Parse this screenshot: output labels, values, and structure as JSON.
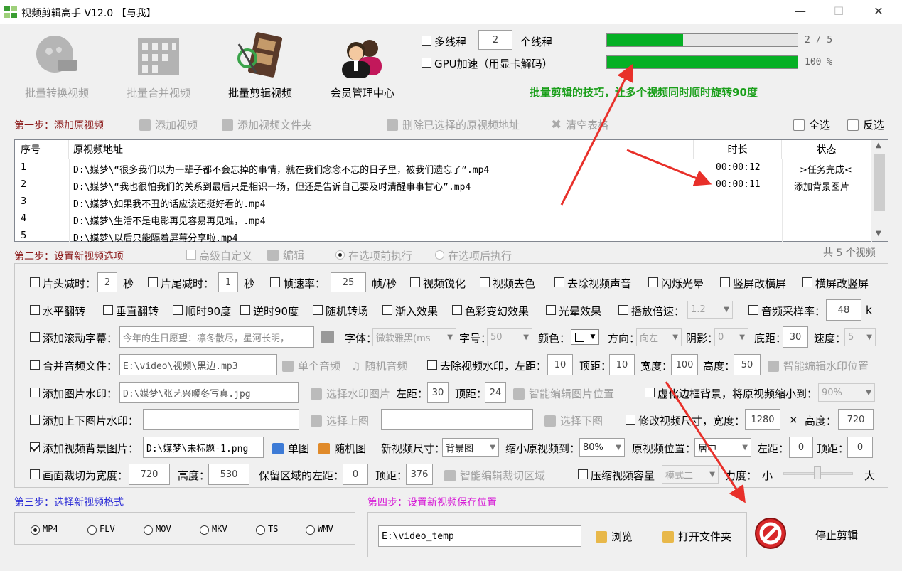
{
  "window": {
    "title": "视频剪辑高手 V12.0  【与我】"
  },
  "toolbar": [
    {
      "label": "批量转换视频",
      "icon": "batch-convert-icon"
    },
    {
      "label": "批量合并视频",
      "icon": "batch-merge-icon"
    },
    {
      "label": "批量剪辑视频",
      "icon": "film-reel-icon"
    },
    {
      "label": "会员管理中心",
      "icon": "members-icon"
    }
  ],
  "threads": {
    "multi_label": "多线程",
    "count": "2",
    "unit": "个线程",
    "gpu_label": "GPU加速（用显卡解码）"
  },
  "progress": {
    "file_text": "2 / 5",
    "file_fraction": 0.4,
    "overall_text": "100 %",
    "overall_fraction": 1.0
  },
  "tip": "批量剪辑的技巧，让多个视频同时顺时旋转90度",
  "step1": {
    "title": "第一步：添加原视频",
    "add_video": "添加视频",
    "add_folder": "添加视频文件夹",
    "delete_selected": "删除已选择的原视频地址",
    "clear_table": "清空表格",
    "select_all": "全选",
    "invert": "反选"
  },
  "table": {
    "headers": [
      "序号",
      "原视频地址",
      "时长",
      "状态"
    ],
    "rows": [
      {
        "no": "1",
        "path": "D:\\媒梦\\“很多我们以为一辈子都不会忘掉的事情，就在我们念念不忘的日子里，被我们遗忘了”.mp4",
        "duration": "00:00:12",
        "status": ">任务完成<"
      },
      {
        "no": "2",
        "path": "D:\\媒梦\\“我也很怕我们的关系到最后只是相识一场，但还是告诉自己要及时清醒事事甘心”.mp4",
        "duration": "00:00:11",
        "status": "添加背景图片"
      },
      {
        "no": "3",
        "path": "D:\\媒梦\\如果我不丑的话应该还挺好看的.mp4",
        "duration": "",
        "status": ""
      },
      {
        "no": "4",
        "path": "D:\\媒梦\\生活不是电影再见容易再见难，.mp4",
        "duration": "",
        "status": ""
      },
      {
        "no": "5",
        "path": "D:\\媒梦\\以后只能隔着屏幕分享啦.mp4",
        "duration": "",
        "status": ""
      }
    ]
  },
  "step2": {
    "title": "第二步：设置新视频选项",
    "advanced": "高级自定义",
    "edit": "编辑",
    "before": "在选项前执行",
    "after": "在选项后执行",
    "total": "共 5 个视频"
  },
  "opts": {
    "head_cut": "片头减时：",
    "head_val": "2",
    "sec": "秒",
    "tail_cut": "片尾减时：",
    "tail_val": "1",
    "fps": "帧速率：",
    "fps_val": "25",
    "fps_unit": "帧/秒",
    "sharpen": "视频锐化",
    "decolor": "视频去色",
    "mute": "去除视频声音",
    "flash": "闪烁光晕",
    "v2h": "竖屏改横屏",
    "h2v": "横屏改竖屏",
    "hflip": "水平翻转",
    "vflip": "垂直翻转",
    "cw90": "顺时90度",
    "ccw90": "逆时90度",
    "random_trans": "随机转场",
    "fade_in": "渐入效果",
    "color_fx": "色彩变幻效果",
    "halo_fx": "光晕效果",
    "speed": "播放倍速：",
    "speed_val": "1.2",
    "sample": "音频采样率：",
    "sample_val": "48",
    "sample_unit": "k",
    "scroll_text": "添加滚动字幕：",
    "scroll_val": "今年的生日愿望：凛冬散尽，星河长明，",
    "font": "字体：",
    "font_val": "微软雅黑(ms",
    "size": "字号：",
    "size_val": "50",
    "color": "颜色：",
    "dir": "方向：",
    "dir_val": "向左",
    "shadow": "阴影：",
    "shadow_val": "0",
    "bottom": "底距：",
    "bottom_val": "30",
    "rate": "速度：",
    "rate_val": "5",
    "merge_audio": "合并音频文件：",
    "audio_path": "E:\\video\\视频\\黑边.mp3",
    "single_audio": "单个音频",
    "random_audio": "随机音频",
    "remove_wm": "去除视频水印，左距：",
    "wm_left": "10",
    "top": "顶距：",
    "wm_top": "10",
    "width": "宽度：",
    "wm_w": "100",
    "height": "高度：",
    "wm_h": "50",
    "smart_wm": "智能编辑水印位置",
    "img_wm": "添加图片水印：",
    "img_wm_path": "D:\\媒梦\\张艺兴暖冬写真.jpg",
    "choose_wm": "选择水印图片",
    "left": "左距：",
    "img_left": "30",
    "img_top": "24",
    "smart_img": "智能编辑图片位置",
    "blur_bg": "虚化边框背景，将原视频缩小到：",
    "blur_val": "90%",
    "topbottom_wm": "添加上下图片水印：",
    "choose_top": "选择上图",
    "choose_bottom": "选择下图",
    "resize": "修改视频尺寸，宽度：",
    "resize_w": "1280",
    "x": "×",
    "height2": "高度：",
    "resize_h": "720",
    "bg_img": "添加视频背景图片：",
    "bg_path": "D:\\媒梦\\未标题-1.png",
    "single_img": "单图",
    "random_img": "随机图",
    "new_size": "新视频尺寸：",
    "new_size_val": "背景图",
    "shrink": "缩小原视频到：",
    "shrink_val": "80%",
    "pos": "原视频位置：",
    "pos_val": "居中",
    "pos_left": "0",
    "pos_top": "0",
    "crop": "画面裁切为宽度：",
    "crop_w": "720",
    "crop_h_label": "高度：",
    "crop_h": "530",
    "keep_left": "保留区域的左距：",
    "keep_left_val": "0",
    "keep_top": "顶距：",
    "keep_top_val": "376",
    "smart_crop": "智能编辑裁切区域",
    "compress": "压缩视频容量",
    "mode": "模式二",
    "strength": "力度：",
    "small": "小",
    "big": "大"
  },
  "step3": {
    "title": "第三步：选择新视频格式",
    "formats": [
      "MP4",
      "FLV",
      "MOV",
      "MKV",
      "TS",
      "WMV"
    ],
    "selected": "MP4"
  },
  "step4": {
    "title": "第四步：设置新视频保存位置",
    "path": "E:\\video_temp",
    "browse": "浏览",
    "open_folder": "打开文件夹"
  },
  "stop": "停止剪辑",
  "colors": {
    "progress": "#06b025",
    "tip": "#1a9f1a",
    "step": "#8b1a1a",
    "arrow": "#e8302a"
  }
}
